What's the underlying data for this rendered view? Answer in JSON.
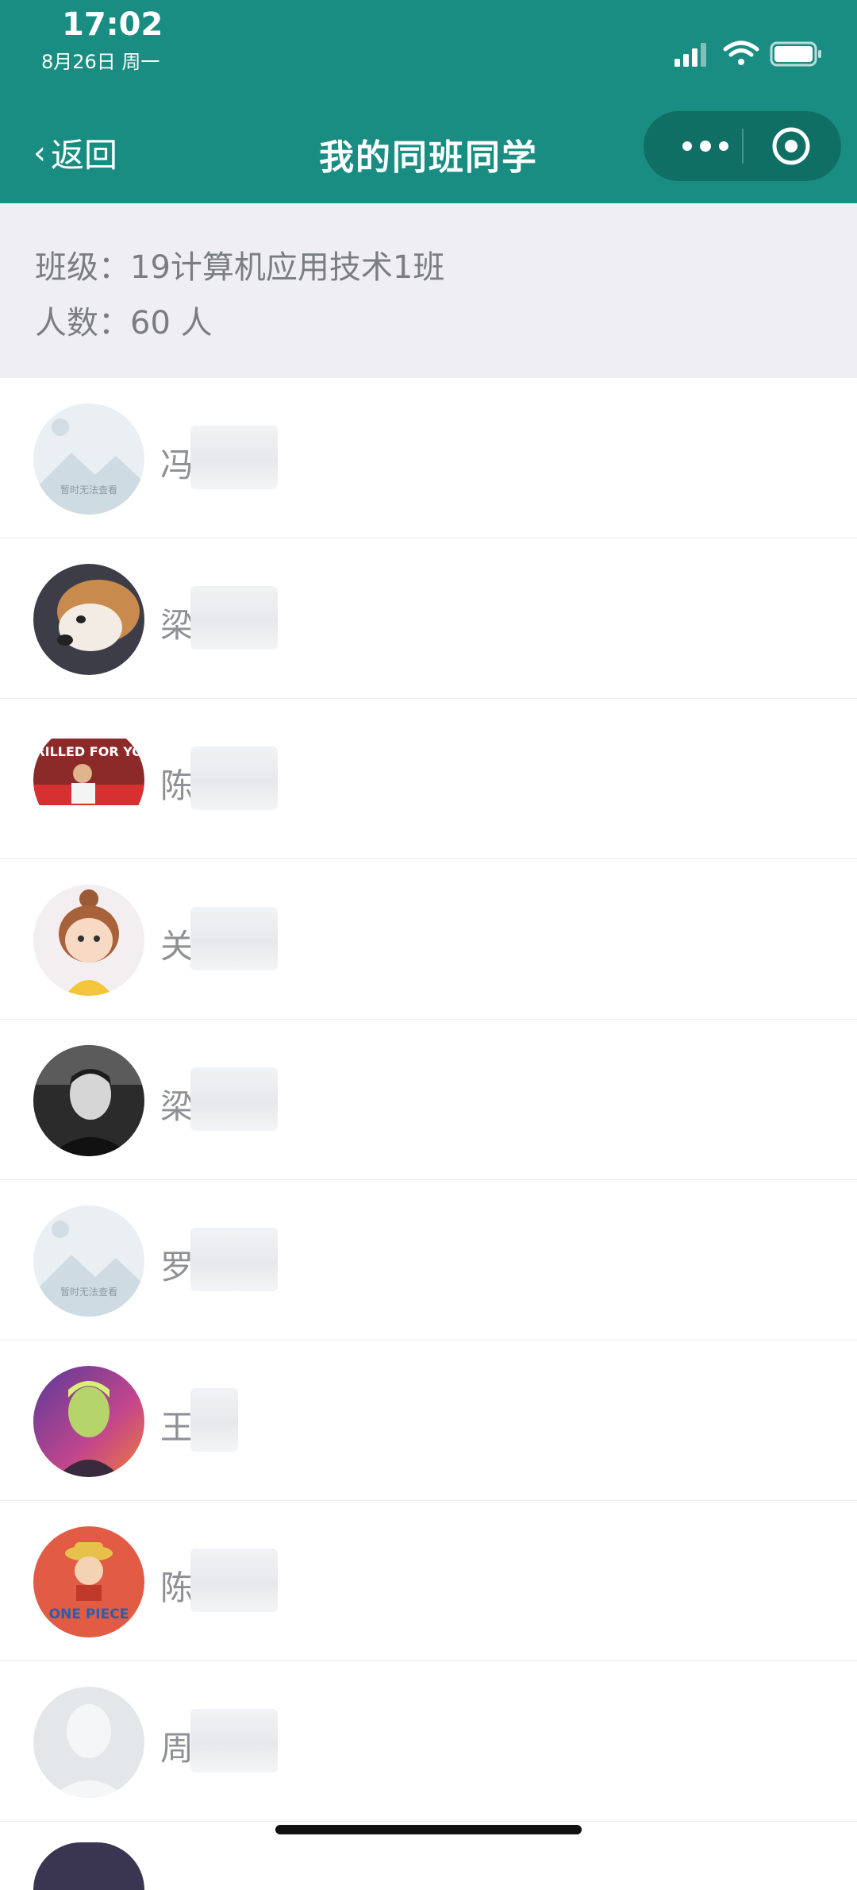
{
  "status_bar": {
    "time": "17:02",
    "date": "8月26日 周一"
  },
  "nav": {
    "back_label": "返回",
    "title": "我的同班同学"
  },
  "class_info": {
    "class_line": "班级：19计算机应用技术1班",
    "count_line": "人数：60 人"
  },
  "students": [
    {
      "name": "冯",
      "avatar": "placeholder-image-icon",
      "placeholder_text": "暂时无法查看"
    },
    {
      "name": "梁",
      "avatar": "dog-photo"
    },
    {
      "name": "陈",
      "avatar": "grilled-for-you-photo",
      "sign_text": "GRILLED FOR YOU"
    },
    {
      "name": "关",
      "avatar": "cartoon-girl"
    },
    {
      "name": "梁",
      "avatar": "man-portrait-bw"
    },
    {
      "name": "罗",
      "avatar": "placeholder-image-icon",
      "placeholder_text": "暂时无法查看"
    },
    {
      "name": "王",
      "avatar": "gradient-portrait"
    },
    {
      "name": "陈",
      "avatar": "one-piece-cartoon",
      "sign_text": "ONE PIECE"
    },
    {
      "name": "周",
      "avatar": "default-avatar-icon"
    }
  ],
  "colors": {
    "header": "#1a8d82",
    "info_bg": "#efeff3"
  }
}
